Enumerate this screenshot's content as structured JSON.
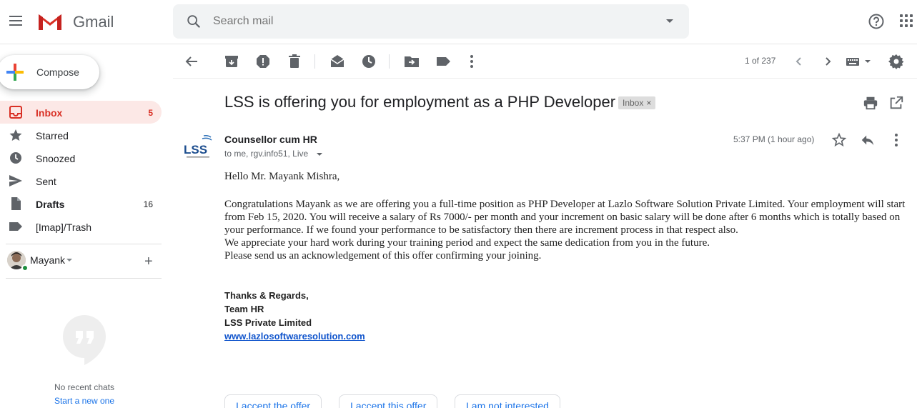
{
  "app": {
    "name": "Gmail"
  },
  "search": {
    "placeholder": "Search mail"
  },
  "sidebar": {
    "compose_label": "Compose",
    "items": [
      {
        "label": "Inbox",
        "count": "5",
        "icon": "inbox-icon"
      },
      {
        "label": "Starred",
        "count": "",
        "icon": "star-icon"
      },
      {
        "label": "Snoozed",
        "count": "",
        "icon": "clock-icon"
      },
      {
        "label": "Sent",
        "count": "",
        "icon": "send-icon"
      },
      {
        "label": "Drafts",
        "count": "16",
        "icon": "draft-icon"
      },
      {
        "label": "[Imap]/Trash",
        "count": "",
        "icon": "label-icon"
      }
    ],
    "user_name": "Mayank",
    "no_chats": "No recent chats",
    "start_chat": "Start a new one"
  },
  "toolbar": {
    "page_count": "1 of 237"
  },
  "message": {
    "subject": "LSS is offering you for employment as a PHP Developer",
    "label_chip": "Inbox",
    "sender": "Counsellor cum HR",
    "recipients": "to me, rgv.info51, Live",
    "time": "5:37 PM (1 hour ago)",
    "greeting": "Hello Mr. Mayank Mishra,",
    "body_lines": [
      "Congratulations Mayank as we are offering you a full-time position as PHP Developer at Lazlo Software Solution Private Limited. Your employment will start from Feb 15, 2020. You will receive a salary of Rs 7000/- per month and your increment on basic salary will be done after 6 months which is totally based on your performance. If we found your performance to be satisfactory then there are increment process in that respect also.",
      "We appreciate your hard work during your training period and expect the same dedication from you in the future.",
      "Please send us an acknowledgement of this offer confirming your joining."
    ],
    "signoff": [
      "Thanks & Regards,",
      "Team HR",
      "LSS Private Limited"
    ],
    "website": "www.lazlosoftwaresolution.com",
    "logo_text": "LSS"
  },
  "smart_replies": [
    "I accept the offer",
    "I accept this offer",
    "I am not interested"
  ],
  "colors": {
    "brand_red": "#d93025",
    "active_bg": "#fce8e6",
    "link": "#1155cc",
    "chip_blue": "#1a73e8"
  }
}
